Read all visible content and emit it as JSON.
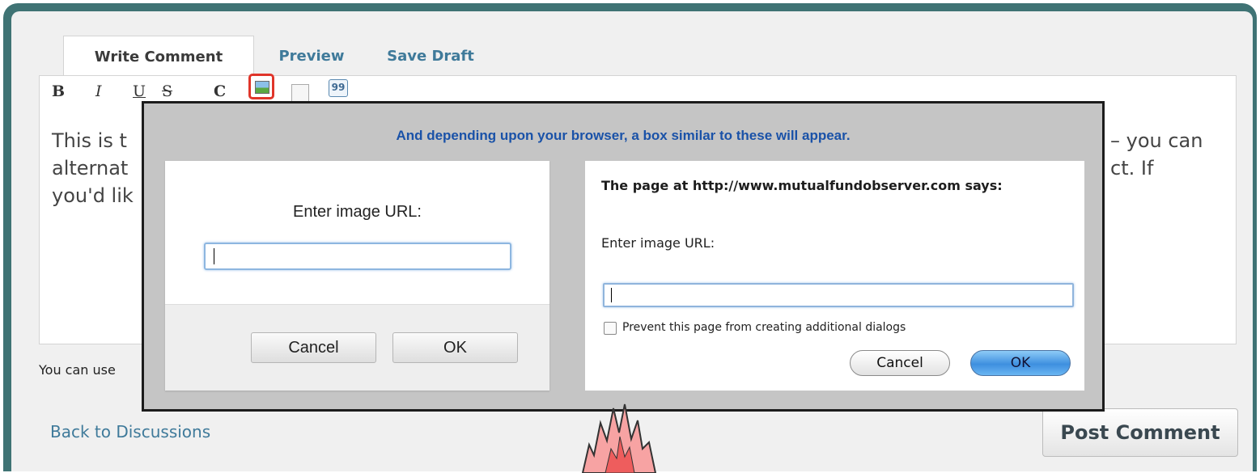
{
  "tabs": {
    "write": "Write Comment",
    "preview": "Preview",
    "save_draft": "Save Draft"
  },
  "toolbar": {
    "bold": "B",
    "italic": "I",
    "underline": "U",
    "strike": "S",
    "code": "C",
    "image_icon": "image-icon",
    "link_icon": "link-icon",
    "quote_icon": "quote-icon",
    "quote_glyph": "99"
  },
  "editor": {
    "line1_start": "This is t",
    "line1_end": "– you can",
    "line2_start": "alternat",
    "line2_end": "ct. If",
    "line3_start": "you'd lik"
  },
  "hint": "You can use",
  "callout": {
    "caption": "And depending upon your browser, a box similar to these will appear.",
    "dialog_a": {
      "prompt": "Enter image URL:",
      "cancel": "Cancel",
      "ok": "OK"
    },
    "dialog_b": {
      "header": "The page at http://www.mutualfundobserver.com says:",
      "prompt": "Enter image URL:",
      "checkbox_label": "Prevent this page from creating additional dialogs",
      "cancel": "Cancel",
      "ok": "OK"
    }
  },
  "footer": {
    "back_link": "Back to Discussions",
    "post_button": "Post Comment"
  },
  "colors": {
    "frame": "#3f7374",
    "link": "#3f7a9a",
    "highlight": "#e0352a",
    "caption": "#1a52a8",
    "spike": "#f07a7a"
  }
}
